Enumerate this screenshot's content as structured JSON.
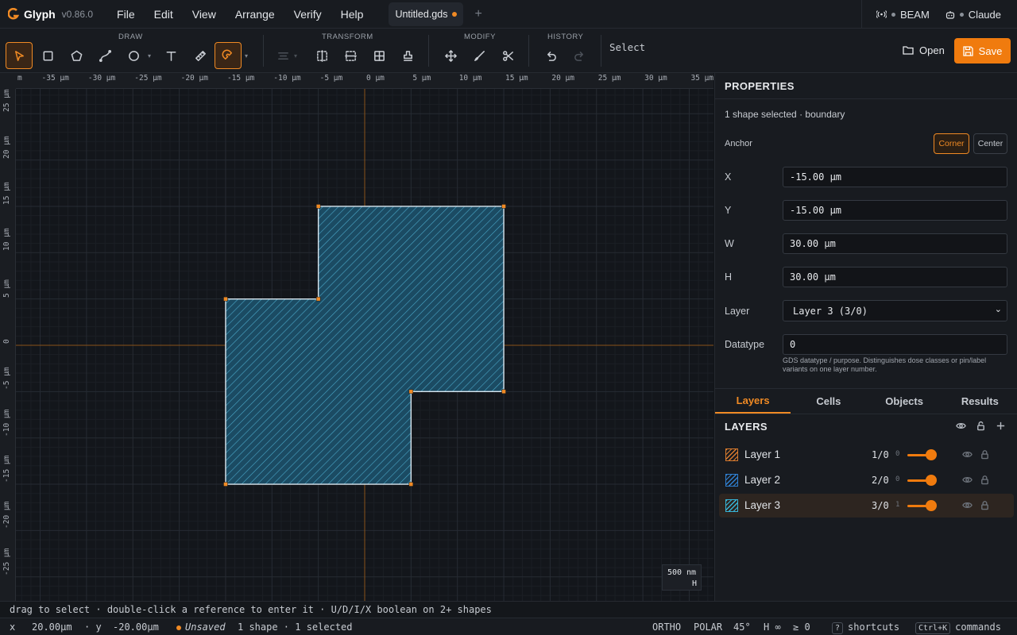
{
  "app": {
    "name": "Glyph",
    "version": "v0.86.0",
    "accent": "#f07b0e"
  },
  "menu": [
    "File",
    "Edit",
    "View",
    "Arrange",
    "Verify",
    "Help"
  ],
  "tab": {
    "title": "Untitled.gds",
    "unsaved": true
  },
  "status_pills": [
    "BEAM",
    "Claude"
  ],
  "toolbar": {
    "groups": [
      "DRAW",
      "TRANSFORM",
      "MODIFY",
      "HISTORY"
    ],
    "mode": "Select",
    "open_label": "Open",
    "save_label": "Save"
  },
  "rulers": {
    "top": [
      "m",
      "-35 µm",
      "-30 µm",
      "-25 µm",
      "-20 µm",
      "-15 µm",
      "-10 µm",
      "-5 µm",
      "0 µm",
      "5 µm",
      "10 µm",
      "15 µm",
      "20 µm",
      "25 µm",
      "30 µm",
      "35 µm"
    ],
    "left": [
      "25 µm",
      "20 µm",
      "15 µm",
      "10 µm",
      "5 µm",
      "0",
      "-5 µm",
      "-10 µm",
      "-15 µm",
      "-20 µm",
      "-25 µm"
    ]
  },
  "shape": {
    "vertices_um": [
      [
        -15,
        -15
      ],
      [
        5,
        -15
      ],
      [
        5,
        -5
      ],
      [
        15,
        -5
      ],
      [
        15,
        15
      ],
      [
        -5,
        15
      ],
      [
        -5,
        5
      ],
      [
        -15,
        5
      ]
    ]
  },
  "scale_box": {
    "value": "500 nm",
    "mode": "H"
  },
  "properties": {
    "title": "PROPERTIES",
    "selection": "1 shape selected · boundary",
    "anchor_label": "Anchor",
    "anchor_options": [
      "Corner",
      "Center"
    ],
    "anchor_selected": "Corner",
    "x_label": "X",
    "x_value": "-15.00 µm",
    "y_label": "Y",
    "y_value": "-15.00 µm",
    "w_label": "W",
    "w_value": "30.00 µm",
    "h_label": "H",
    "h_value": "30.00 µm",
    "layer_label": "Layer",
    "layer_value": "Layer 3 (3/0)",
    "datatype_label": "Datatype",
    "datatype_value": "0",
    "datatype_hint": "GDS datatype / purpose. Distinguishes dose classes or pin/label variants on one layer number."
  },
  "panel_tabs": [
    "Layers",
    "Cells",
    "Objects",
    "Results"
  ],
  "panel_tab_active": "Layers",
  "layers_title": "LAYERS",
  "layers": [
    {
      "name": "Layer 1",
      "num": "1/0",
      "count": "0",
      "color": "#d77a2e",
      "opacity": 1.0
    },
    {
      "name": "Layer 2",
      "num": "2/0",
      "count": "0",
      "color": "#2f7fd0",
      "opacity": 1.0
    },
    {
      "name": "Layer 3",
      "num": "3/0",
      "count": "1",
      "color": "#37b5d8",
      "opacity": 1.0,
      "selected": true
    }
  ],
  "hint_text": "drag to select · double-click a reference to enter it · U/D/I/X boolean on 2+ shapes",
  "statusbar": {
    "x_label": "x",
    "x_value": "20.00µm",
    "y_label": "· y",
    "y_value": "-20.00µm",
    "unsaved": "Unsaved",
    "counts": "1 shape · 1 selected",
    "ortho": "ORTHO",
    "polar": "POLAR",
    "angle": "45°",
    "h_inf": "H ∞",
    "ge_zero": "≥ 0",
    "shortcuts_key": "?",
    "shortcuts": "shortcuts",
    "commands_key": "Ctrl+K",
    "commands": "commands"
  }
}
